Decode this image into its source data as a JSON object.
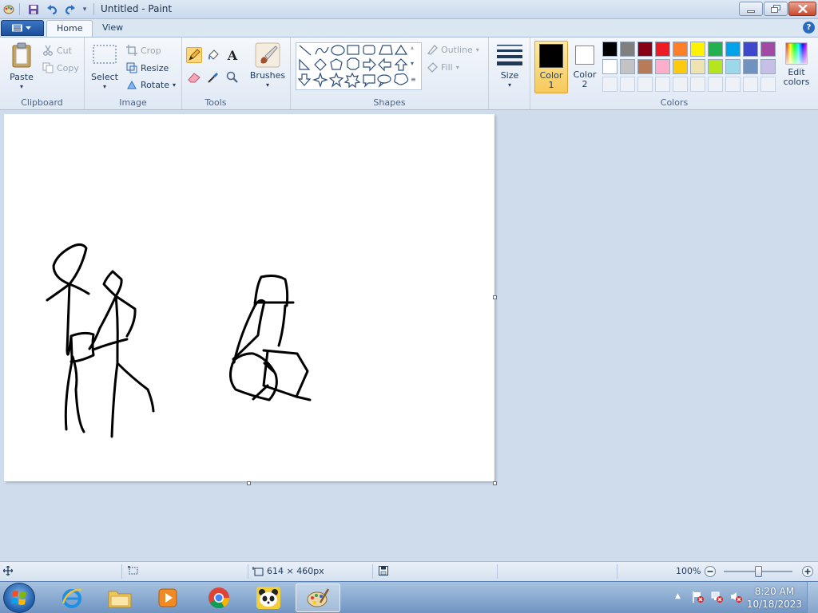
{
  "window": {
    "title": "Untitled - Paint"
  },
  "tabs": {
    "home": "Home",
    "view": "View"
  },
  "clipboard": {
    "group_label": "Clipboard",
    "paste": "Paste",
    "cut": "Cut",
    "copy": "Copy"
  },
  "image": {
    "group_label": "Image",
    "select": "Select",
    "crop": "Crop",
    "resize": "Resize",
    "rotate": "Rotate"
  },
  "tools": {
    "group_label": "Tools",
    "brushes": "Brushes",
    "icons": [
      "pencil-icon",
      "fill-icon",
      "text-icon",
      "eraser-icon",
      "color-picker-icon",
      "magnifier-icon"
    ]
  },
  "shapes": {
    "group_label": "Shapes",
    "outline": "Outline",
    "fill": "Fill"
  },
  "size": {
    "label": "Size"
  },
  "colors": {
    "group_label": "Colors",
    "color1_label": "Color",
    "color1_num": "1",
    "color2_label": "Color",
    "color2_num": "2",
    "color1": "#000000",
    "color2": "#ffffff",
    "edit_colors_1": "Edit",
    "edit_colors_2": "colors",
    "palette_row1": [
      "#000000",
      "#7f7f7f",
      "#880015",
      "#ed1c24",
      "#ff7f27",
      "#fff200",
      "#22b14c",
      "#00a2e8",
      "#3f48cc",
      "#a349a4"
    ],
    "palette_row2": [
      "#ffffff",
      "#c3c3c3",
      "#b97a57",
      "#ffaec9",
      "#ffc90e",
      "#efe4b0",
      "#b5e61d",
      "#99d9ea",
      "#7092be",
      "#c8bfe7"
    ]
  },
  "status": {
    "canvas_size": "614 × 460px",
    "zoom": "100%"
  },
  "taskbar": {
    "time": "8:20 AM",
    "date": "10/18/2023"
  }
}
